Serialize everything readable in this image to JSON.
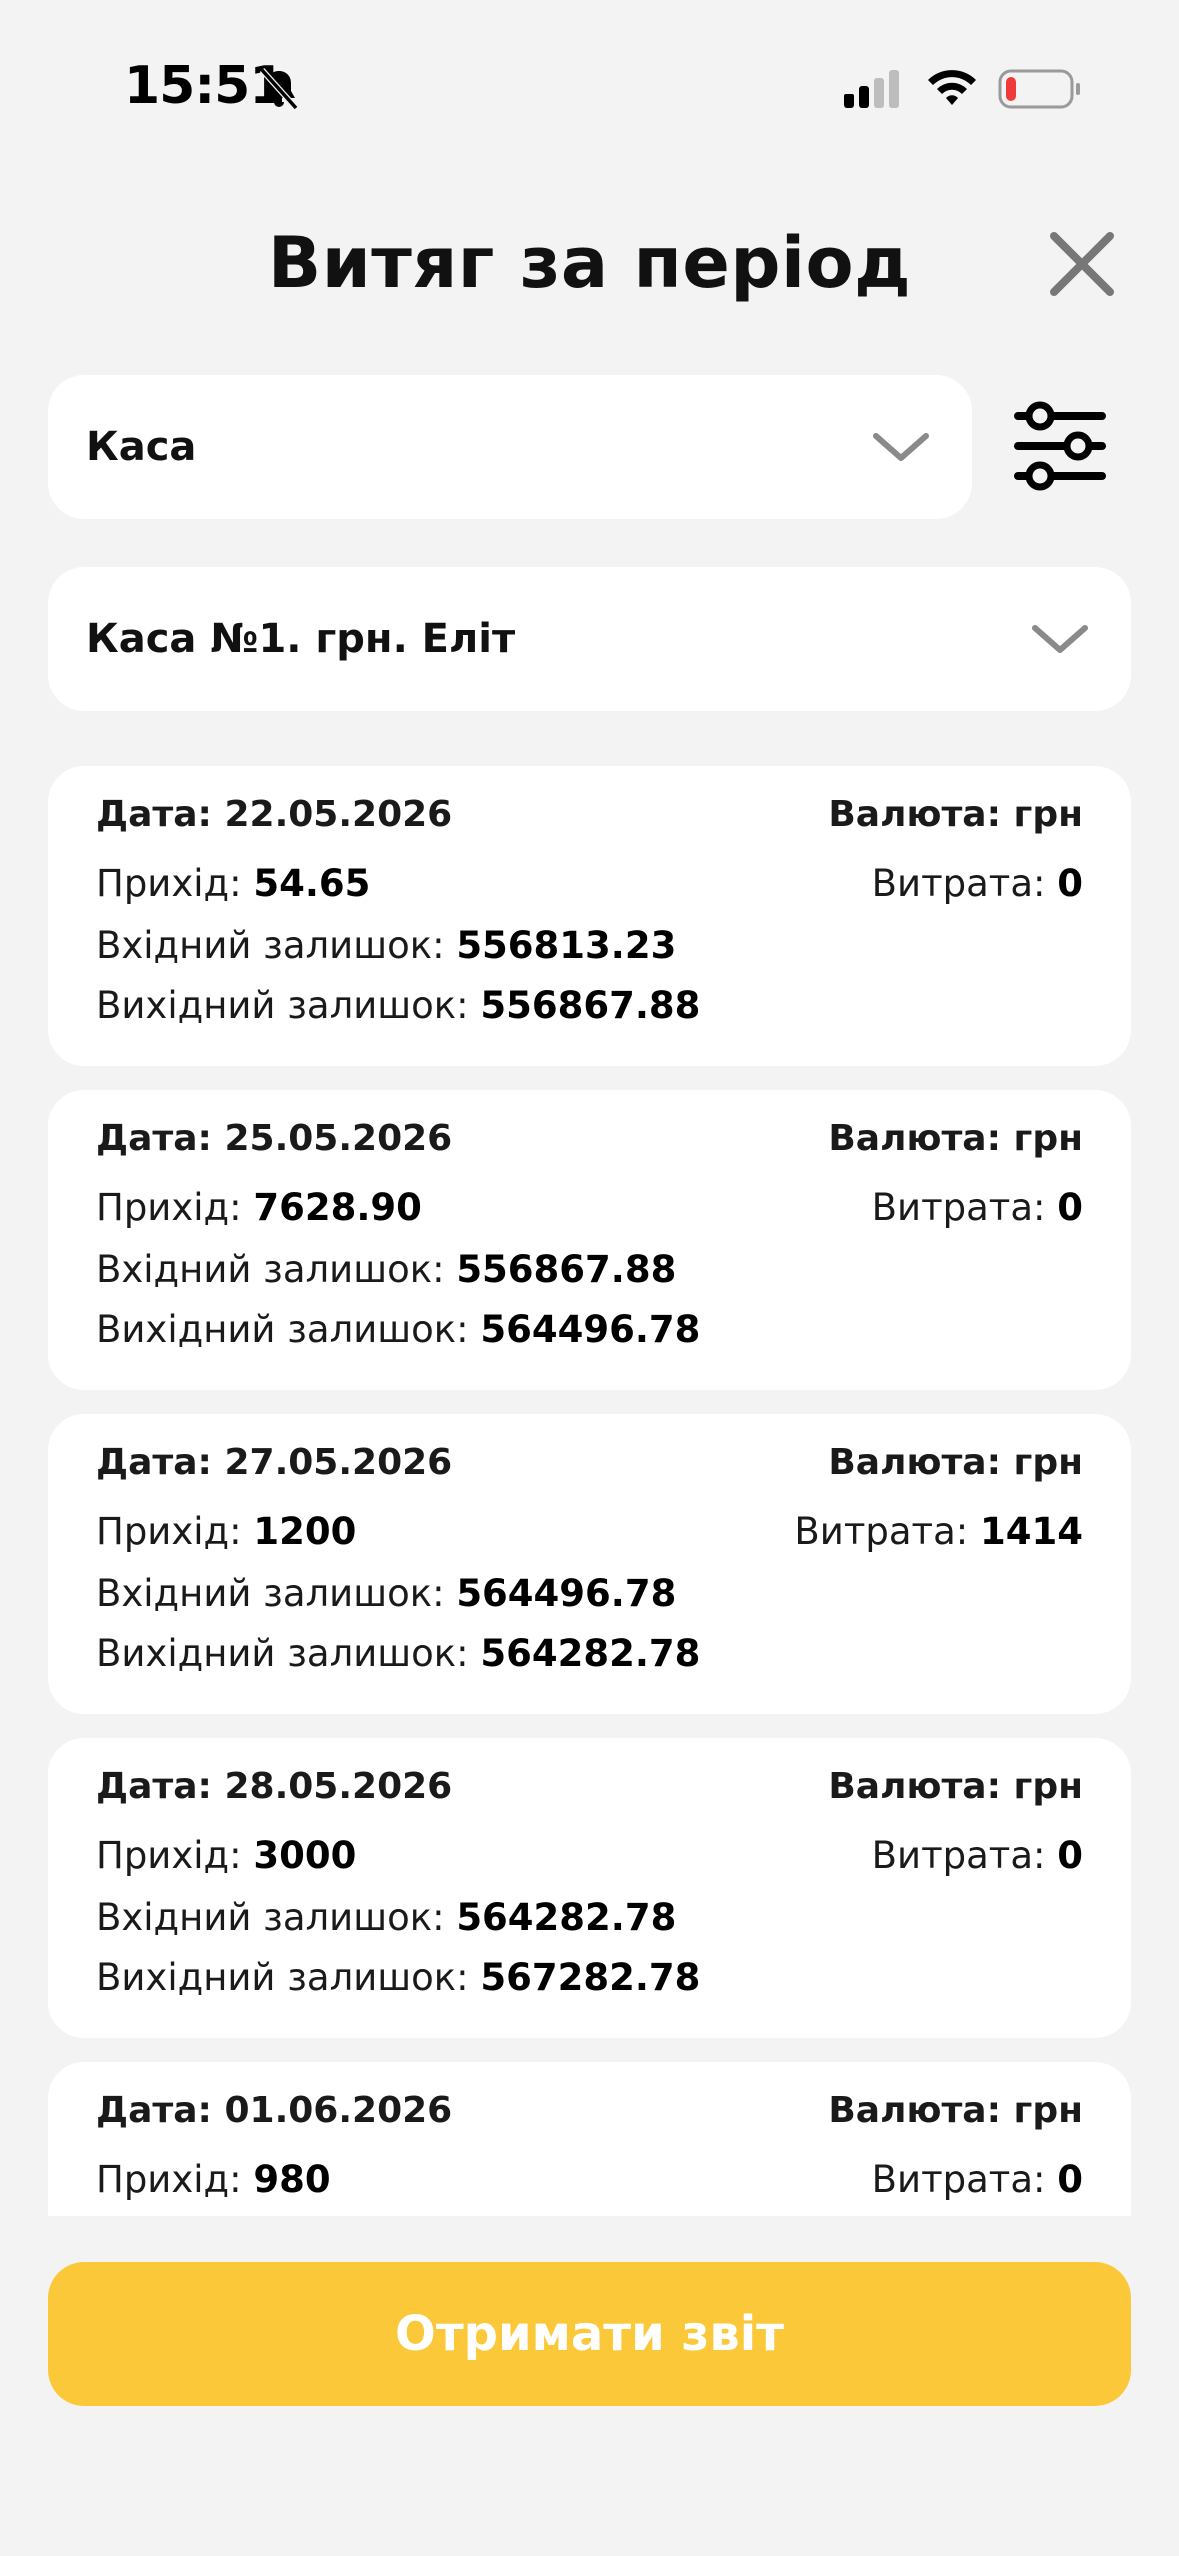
{
  "status_bar": {
    "time": "15:51",
    "icons": [
      "bell-slash-icon",
      "cellular-signal-icon",
      "wifi-icon",
      "battery-icon"
    ],
    "battery_color": "#f03a3a"
  },
  "header": {
    "title": "Витяг за період",
    "close_icon": "close-icon"
  },
  "filters": {
    "account_type": "Каса",
    "cashbox": "Каса №1. грн. Еліт",
    "filter_icon": "sliders-icon"
  },
  "labels": {
    "date": "Дата:",
    "currency": "Валюта:",
    "income": "Прихід:",
    "expense": "Витрата:",
    "opening_balance": "Вхідний залишок:",
    "closing_balance": "Вихідний залишок:"
  },
  "entries": [
    {
      "date": "22.05.2026",
      "currency": "грн",
      "income": "54.65",
      "expense": "0",
      "opening_balance": "556813.23",
      "closing_balance": "556867.88"
    },
    {
      "date": "25.05.2026",
      "currency": "грн",
      "income": "7628.90",
      "expense": "0",
      "opening_balance": "556867.88",
      "closing_balance": "564496.78"
    },
    {
      "date": "27.05.2026",
      "currency": "грн",
      "income": "1200",
      "expense": "1414",
      "opening_balance": "564496.78",
      "closing_balance": "564282.78"
    },
    {
      "date": "28.05.2026",
      "currency": "грн",
      "income": "3000",
      "expense": "0",
      "opening_balance": "564282.78",
      "closing_balance": "567282.78"
    },
    {
      "date": "01.06.2026",
      "currency": "грн",
      "income": "980",
      "expense": "0"
    }
  ],
  "actions": {
    "get_report": "Отримати звіт"
  },
  "colors": {
    "background": "#f3f3f3",
    "card": "#ffffff",
    "accent": "#fbc83a",
    "text": "#111111",
    "icon_gray": "#7a7a7a"
  }
}
